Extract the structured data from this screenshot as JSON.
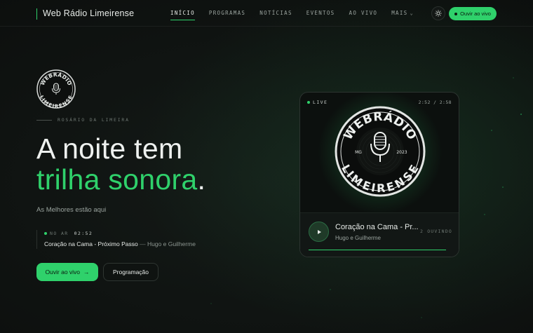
{
  "brand": {
    "name": "Web Rádio Limeirense"
  },
  "nav": {
    "items": [
      {
        "label": "INÍCIO",
        "active": true
      },
      {
        "label": "PROGRAMAS"
      },
      {
        "label": "NOTÍCIAS"
      },
      {
        "label": "EVENTOS"
      },
      {
        "label": "AO VIVO"
      },
      {
        "label": "MAIS"
      }
    ]
  },
  "header": {
    "theme_icon": "sun-icon",
    "listen_label": "Ouvir ao vivo"
  },
  "hero": {
    "logo_top": "WEBRÁDIO",
    "logo_bottom": "LIMEIRENSE",
    "kicker": "ROSÁRIO DA LIMEIRA",
    "headline_1": "A noite tem",
    "headline_2": "trilha sonora",
    "headline_period": ".",
    "tagline": "As Melhores estão aqui",
    "now_label": "NO AR",
    "now_time": "02:52",
    "now_track": "Coração na Cama - Próximo Passo",
    "now_sep": " — ",
    "now_artist": "Hugo e Guilherme",
    "primary_label": "Ouvir ao vivo",
    "primary_arrow": "→",
    "secondary_label": "Programação"
  },
  "player": {
    "live_label": "LIVE",
    "time": "2:52 / 2:58",
    "logo_top": "WEBRÁDIO",
    "logo_bottom": "LIMEIRENSE",
    "logo_state": "MG",
    "logo_year": "2023",
    "track": "Coração na Cama - Pr...",
    "artist": "Hugo e Guilherme",
    "listeners": "2 OUVINDO",
    "progress": 0.98
  },
  "colors": {
    "accent": "#2fd16b",
    "background": "#0b0d0c"
  }
}
